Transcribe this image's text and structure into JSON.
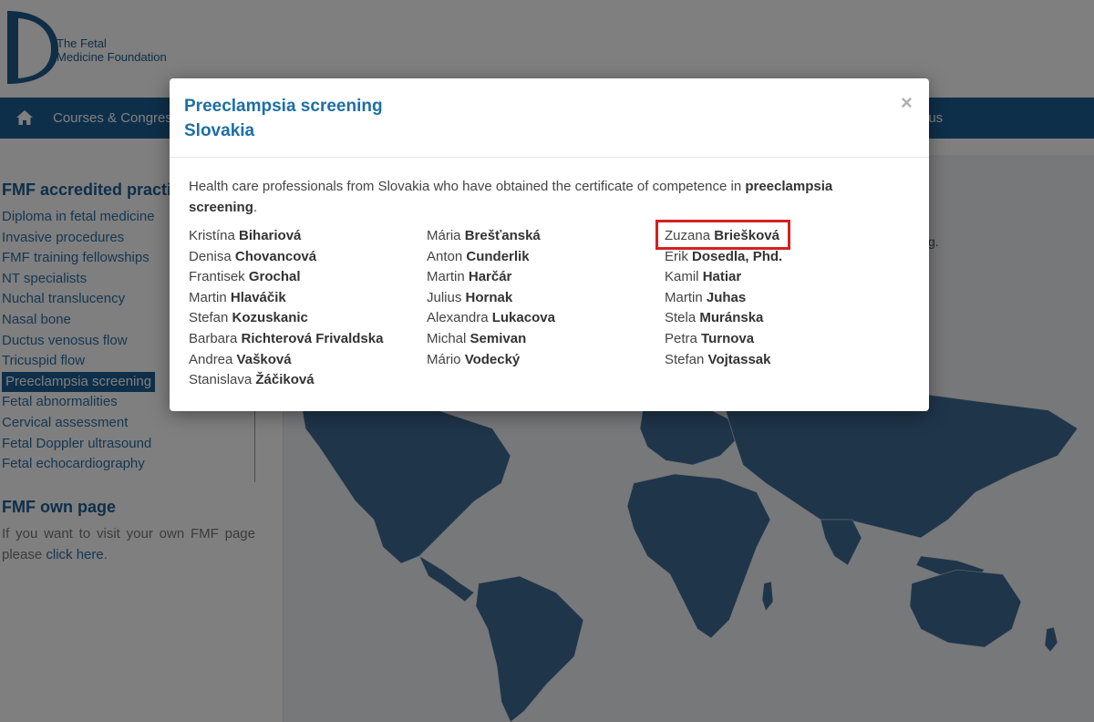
{
  "header": {
    "logo_text_line1": "The Fetal",
    "logo_text_line2": "Medicine Foundation"
  },
  "nav": {
    "courses": "Courses & Congres",
    "about": "t us"
  },
  "sidebar": {
    "accredited_title": "FMF accredited practi",
    "items": [
      "Diploma in fetal medicine",
      "Invasive procedures",
      "FMF training fellowships",
      "NT specialists",
      "Nuchal translucency",
      "Nasal bone",
      "Ductus venosus flow",
      "Tricuspid flow",
      "Preeclampsia screening",
      "Fetal abnormalities",
      "Cervical assessment",
      "Fetal Doppler ultrasound",
      "Fetal echocardiography"
    ],
    "active_index": 8,
    "own_page_title": "FMF own page",
    "own_page_text": "If you want to visit your own FMF page please",
    "own_page_link": "click here",
    "own_page_end": "."
  },
  "map": {
    "stray_char": "g."
  },
  "modal": {
    "title_line1": "Preeclampsia screening",
    "title_line2": "Slovakia",
    "close": "×",
    "intro_pre": "Health care professionals from Slovakia who have obtained the certificate of competence in ",
    "intro_bold": "preeclampsia screening",
    "intro_post": ".",
    "columns": [
      [
        {
          "first": "Kristína",
          "last": "Bihariová"
        },
        {
          "first": "Denisa",
          "last": "Chovancová"
        },
        {
          "first": "Frantisek",
          "last": "Grochal"
        },
        {
          "first": "Martin",
          "last": "Hlaváčik"
        },
        {
          "first": "Stefan",
          "last": "Kozuskanic"
        },
        {
          "first": "Barbara",
          "last": "Richterová Frivaldska"
        },
        {
          "first": "Andrea",
          "last": "Vašková"
        },
        {
          "first": "Stanislava",
          "last": "Žáčiková"
        }
      ],
      [
        {
          "first": "Mária",
          "last": "Brešťanská"
        },
        {
          "first": "Anton",
          "last": "Cunderlik"
        },
        {
          "first": "Martin",
          "last": "Harčár"
        },
        {
          "first": "Julius",
          "last": "Hornak"
        },
        {
          "first": "Alexandra",
          "last": "Lukacova"
        },
        {
          "first": "Michal",
          "last": "Semivan"
        },
        {
          "first": "Mário",
          "last": "Vodecký"
        }
      ],
      [
        {
          "first": "Zuzana",
          "last": "Briešková"
        },
        {
          "first": "Erik",
          "last": "Dosedla, Phd."
        },
        {
          "first": "Kamil",
          "last": "Hatiar"
        },
        {
          "first": "Martin",
          "last": "Juhas"
        },
        {
          "first": "Stela",
          "last": "Muránska"
        },
        {
          "first": "Petra",
          "last": "Turnova"
        },
        {
          "first": "Stefan",
          "last": "Vojtassak"
        }
      ]
    ]
  },
  "colors": {
    "brand_blue": "#1d5e92",
    "highlight_red": "#d32121"
  }
}
